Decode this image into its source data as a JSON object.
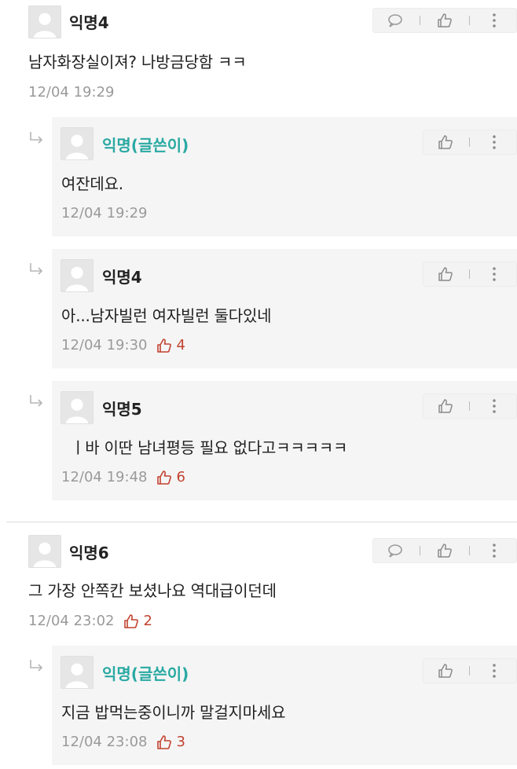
{
  "comments": [
    {
      "author": "익명4",
      "text": "남자화장실이져? 나방금당함 ㅋㅋ",
      "time": "12/04 19:29",
      "likes": ""
    },
    {
      "author": "익명(글쓴이)",
      "text": "여잔데요.",
      "time": "12/04 19:29",
      "likes": ""
    },
    {
      "author": "익명4",
      "text": "아...남자빌런 여자빌런 둘다있네",
      "time": "12/04 19:30",
      "likes": "4"
    },
    {
      "author": "익명5",
      "text": "ㅣ바 이딴 남녀평등 필요 없다고ㅋㅋㅋㅋㅋ",
      "time": "12/04 19:48",
      "likes": "6"
    },
    {
      "author": "익명6",
      "text": "그 가장 안쪽칸 보셨나요 역대급이던데",
      "time": "12/04 23:02",
      "likes": "2"
    },
    {
      "author": "익명(글쓴이)",
      "text": "지금 밥먹는중이니까 말걸지마세요",
      "time": "12/04 23:08",
      "likes": "3"
    }
  ],
  "icons": {
    "comment": "comment-icon",
    "like": "thumbs-up-icon",
    "more": "more-vertical-icon",
    "reply": "reply-arrow-icon",
    "avatar": "default-avatar-icon"
  },
  "colors": {
    "op_author": "#2aa9a3",
    "likes": "#c2422f",
    "reply_bg": "#f5f5f5",
    "meta": "#9a9a9a"
  }
}
